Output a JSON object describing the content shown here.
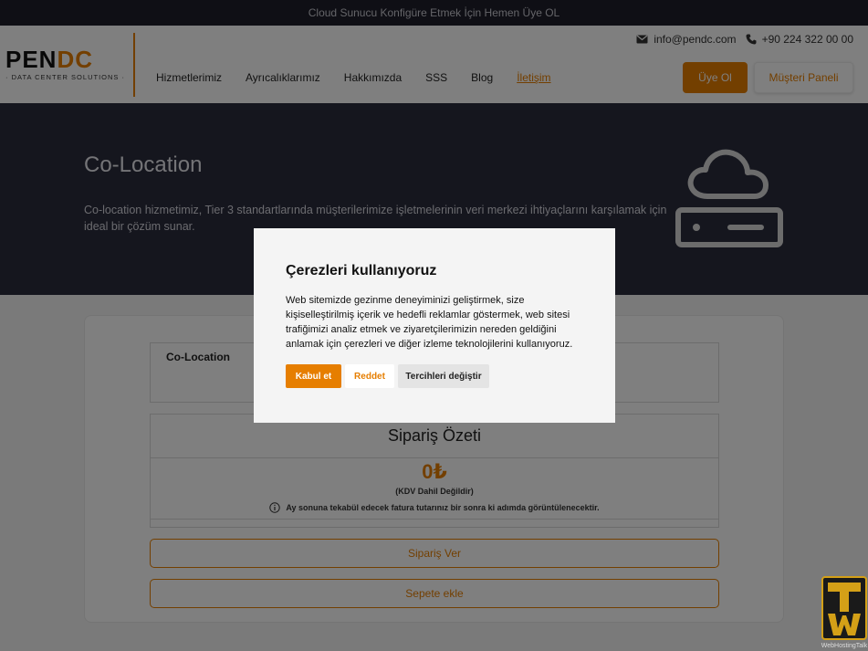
{
  "topbar": {
    "text": "Cloud Sunucu Konfigüre Etmek İçin Hemen Üye OL"
  },
  "logo": {
    "main_left": "PEN",
    "main_right": "DC",
    "sub": "· DATA CENTER SOLUTIONS ·"
  },
  "contact": {
    "email": "info@pendc.com",
    "phone": "+90 224 322 00 00"
  },
  "nav": {
    "items": [
      {
        "label": "Hizmetlerimiz"
      },
      {
        "label": "Ayrıcalıklarımız"
      },
      {
        "label": "Hakkımızda"
      },
      {
        "label": "SSS"
      },
      {
        "label": "Blog"
      },
      {
        "label": "İletişim"
      }
    ]
  },
  "header_buttons": {
    "signup": "Üye Ol",
    "panel": "Müşteri Paneli"
  },
  "hero": {
    "title": "Co-Location",
    "description": "Co-location hizmetimiz, Tier 3 standartlarında müşterilerimize işletmelerinin veri merkezi ihtiyaçlarını karşılamak için ideal bir çözüm sunar."
  },
  "product": {
    "name": "Co-Location"
  },
  "summary": {
    "title": "Sipariş Özeti",
    "price": "0₺",
    "tax_note": "(KDV Dahil Değildir)",
    "info": "Ay sonuna tekabül edecek fatura tutarınız bir sonra ki adımda görüntülenecektir."
  },
  "actions": {
    "order": "Sipariş Ver",
    "cart": "Sepete ekle"
  },
  "cookie_modal": {
    "title": "Çerezleri kullanıyoruz",
    "text": "Web sitemizde gezinme deneyiminizi geliştirmek, size kişiselleştirilmiş içerik ve hedefli reklamlar göstermek, web sitesi trafiğimizi analiz etmek ve ziyaretçilerimizin nereden geldiğini anlamak için çerezleri ve diğer izleme teknolojilerini kullanıyoruz.",
    "accept": "Kabul et",
    "reject": "Reddet",
    "preferences": "Tercihleri değiştir"
  },
  "watermark": {
    "text": "WebHostingTalk"
  },
  "colors": {
    "accent": "#e67e00",
    "hero_bg": "#2a2c3d",
    "topbar_bg": "#1e1f2b"
  }
}
